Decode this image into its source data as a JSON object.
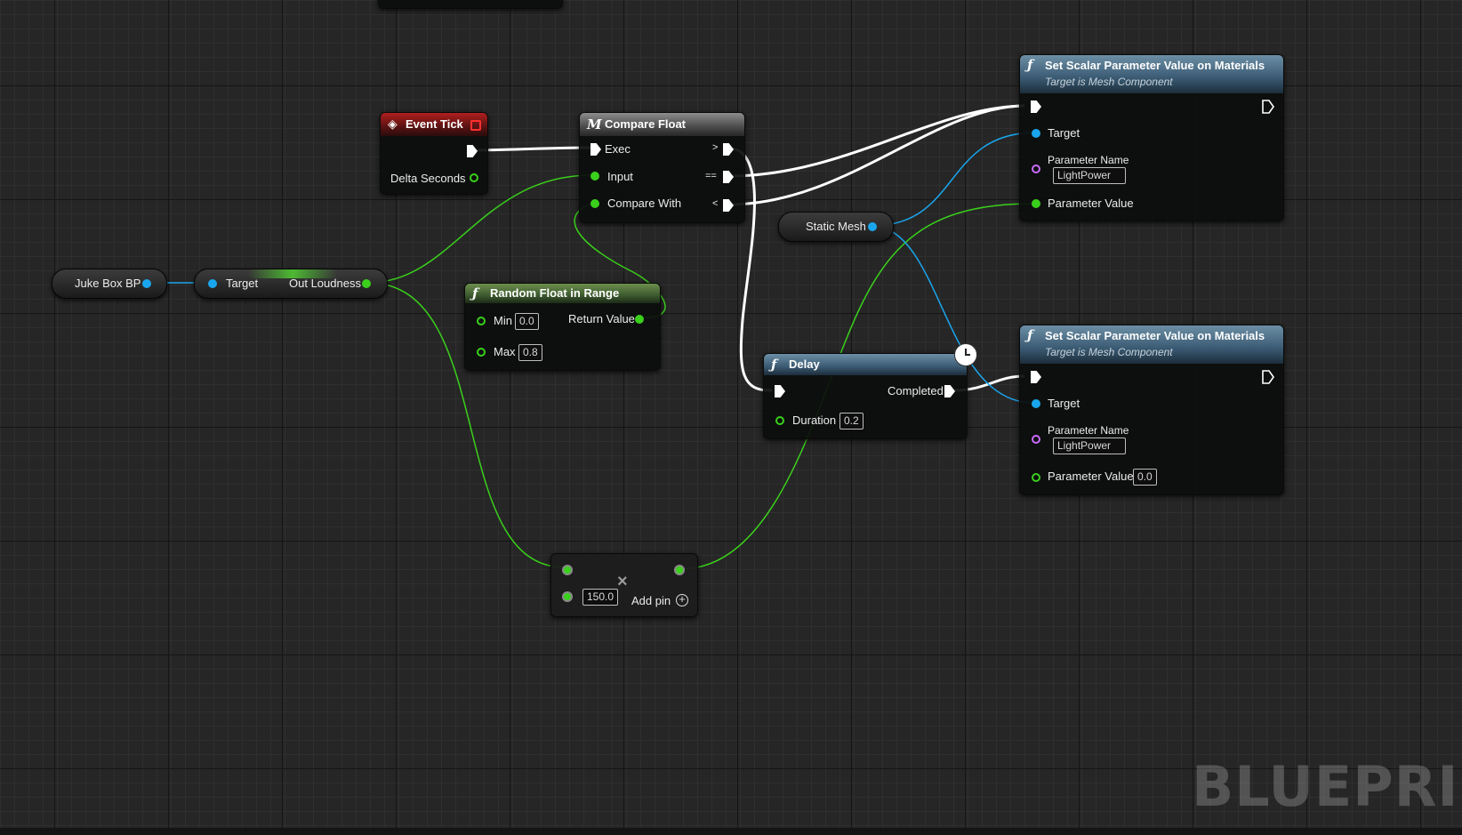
{
  "editor": {
    "watermark": "BLUEPRINT"
  },
  "nodes": {
    "event_tick": {
      "title": "Event Tick",
      "delta_seconds": "Delta Seconds"
    },
    "compare_float": {
      "title": "Compare Float",
      "exec": "Exec",
      "input": "Input",
      "compare_with": "Compare With",
      "gt": ">",
      "eq": "==",
      "lt": "<"
    },
    "juke_box": {
      "label": "Juke Box BP"
    },
    "out_loudness": {
      "target": "Target",
      "output": "Out Loudness"
    },
    "random_float": {
      "title": "Random Float in Range",
      "min_label": "Min",
      "min_value": "0.0",
      "max_label": "Max",
      "max_value": "0.8",
      "return_value": "Return Value"
    },
    "static_mesh": {
      "label": "Static Mesh"
    },
    "set_scalar_1": {
      "title": "Set Scalar Parameter Value on Materials",
      "subtitle": "Target is Mesh Component",
      "target": "Target",
      "param_name_label": "Parameter Name",
      "param_name_value": "LightPower",
      "param_value_label": "Parameter Value"
    },
    "set_scalar_2": {
      "title": "Set Scalar Parameter Value on Materials",
      "subtitle": "Target is Mesh Component",
      "target": "Target",
      "param_name_label": "Parameter Name",
      "param_name_value": "LightPower",
      "param_value_label": "Parameter Value",
      "param_value": "0.0"
    },
    "delay": {
      "title": "Delay",
      "completed": "Completed",
      "duration_label": "Duration",
      "duration_value": "0.2"
    },
    "multiply": {
      "operator": "×",
      "value": "150.0",
      "add_pin": "Add pin"
    }
  },
  "colors": {
    "exec_wire": "#ffffff",
    "float_wire": "#3ad01c",
    "object_wire": "#1aa6ee",
    "name_pin": "#c86bff",
    "event_header": "#b01f1f",
    "function_header": "#3a5a72",
    "pure_header": "#3d5a2f",
    "macro_header": "#4c4c4c"
  },
  "icons": [
    "event-diamond-icon",
    "function-f-icon",
    "macro-m-icon",
    "clock-icon",
    "add-pin-plus-icon",
    "multiply-x-icon"
  ]
}
